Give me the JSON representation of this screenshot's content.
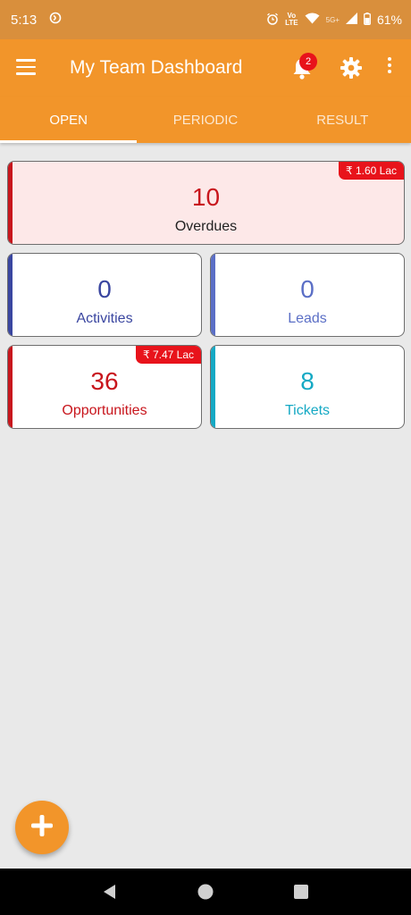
{
  "status_bar": {
    "time": "5:13",
    "network_label_top": "Vo",
    "network_label_bottom": "LTE",
    "network_5g": "5G+",
    "battery": "61%"
  },
  "app_bar": {
    "title": "My Team Dashboard",
    "notification_count": "2"
  },
  "tabs": [
    {
      "label": "OPEN",
      "active": true
    },
    {
      "label": "PERIODIC",
      "active": false
    },
    {
      "label": "RESULT",
      "active": false
    }
  ],
  "cards": {
    "overdues": {
      "value": "10",
      "label": "Overdues",
      "badge": "₹ 1.60 Lac"
    },
    "activities": {
      "value": "0",
      "label": "Activities"
    },
    "leads": {
      "value": "0",
      "label": "Leads"
    },
    "opportunities": {
      "value": "36",
      "label": "Opportunities",
      "badge": "₹ 7.47 Lac"
    },
    "tickets": {
      "value": "8",
      "label": "Tickets"
    }
  },
  "colors": {
    "primary": "#f2952a",
    "status_bar": "#d98f3c",
    "red": "#c8161d",
    "blue": "#3a46a0",
    "light_blue": "#5b6fc6",
    "teal": "#15a9c4",
    "badge_red": "#e8131b"
  },
  "icons": {
    "menu": "hamburger-icon",
    "bell": "bell-icon",
    "settings": "gear-icon",
    "more": "more-vertical-icon",
    "fab": "plus-icon"
  }
}
